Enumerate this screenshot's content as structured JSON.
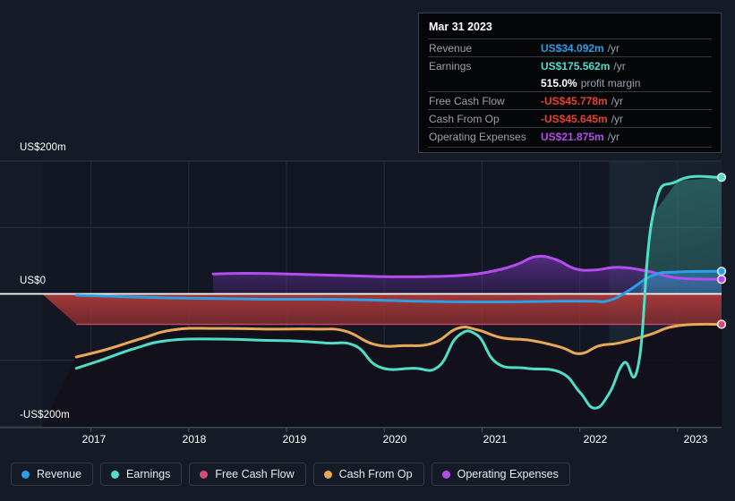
{
  "chart_data": {
    "type": "area",
    "title": "",
    "xlabel": "",
    "ylabel": "",
    "currency": "US$",
    "units": "m",
    "grid": true,
    "legend_position": "bottom",
    "ylim": [
      -200,
      200
    ],
    "yticks": [
      -200,
      0,
      200
    ],
    "ytick_labels": [
      "-US$200m",
      "US$0",
      "US$200m"
    ],
    "xlim": [
      2016.5,
      2023.45
    ],
    "xticks": [
      2017,
      2018,
      2019,
      2020,
      2021,
      2022,
      2023
    ],
    "xtick_labels": [
      "2017",
      "2018",
      "2019",
      "2020",
      "2021",
      "2022",
      "2023"
    ],
    "forecast_start": 2022.3,
    "series": [
      {
        "name": "Revenue",
        "color": "#2b9fe8",
        "x": [
          2016.85,
          2017.3,
          2017.8,
          2018.3,
          2018.8,
          2019.3,
          2019.8,
          2020.3,
          2020.8,
          2021.3,
          2021.8,
          2022.1,
          2022.3,
          2022.5,
          2022.75,
          2023.0,
          2023.45
        ],
        "values": [
          -2,
          -4,
          -6,
          -7,
          -8,
          -8,
          -9,
          -11,
          -12,
          -12,
          -11,
          -11,
          -10,
          5,
          28,
          33,
          34.092
        ]
      },
      {
        "name": "Earnings",
        "color": "#4fdfc8",
        "x": [
          2016.85,
          2017.1,
          2017.45,
          2017.8,
          2018.3,
          2018.8,
          2019.1,
          2019.4,
          2019.7,
          2019.95,
          2020.3,
          2020.55,
          2020.75,
          2020.95,
          2021.15,
          2021.45,
          2021.8,
          2022.0,
          2022.15,
          2022.3,
          2022.45,
          2022.6,
          2022.75,
          2023.0,
          2023.45
        ],
        "values": [
          -112,
          -100,
          -82,
          -70,
          -68,
          -70,
          -71,
          -74,
          -78,
          -110,
          -112,
          -110,
          -64,
          -62,
          -104,
          -112,
          -118,
          -148,
          -172,
          -150,
          -104,
          -106,
          120,
          170,
          175.562
        ]
      },
      {
        "name": "Free Cash Flow",
        "color": "#d94a77",
        "x": [
          2016.85,
          2023.45
        ],
        "values": [
          -45.778,
          -45.778
        ]
      },
      {
        "name": "Cash From Op",
        "color": "#e8a855",
        "x": [
          2016.85,
          2017.15,
          2017.5,
          2017.85,
          2018.3,
          2018.8,
          2019.3,
          2019.6,
          2019.9,
          2020.2,
          2020.5,
          2020.75,
          2020.95,
          2021.2,
          2021.5,
          2021.8,
          2022.0,
          2022.2,
          2022.4,
          2022.7,
          2023.0,
          2023.45
        ],
        "values": [
          -95,
          -84,
          -68,
          -54,
          -52,
          -53,
          -53,
          -56,
          -76,
          -78,
          -74,
          -52,
          -54,
          -66,
          -70,
          -80,
          -90,
          -78,
          -74,
          -62,
          -48,
          -45.645
        ]
      },
      {
        "name": "Operating Expenses",
        "color": "#b44cf0",
        "x": [
          2018.25,
          2018.6,
          2019.0,
          2019.5,
          2020.0,
          2020.4,
          2020.8,
          2021.1,
          2021.35,
          2021.55,
          2021.75,
          2021.95,
          2022.15,
          2022.4,
          2022.7,
          2023.0,
          2023.45
        ],
        "values": [
          30,
          31,
          30,
          28,
          26,
          26,
          28,
          34,
          44,
          56,
          52,
          38,
          36,
          40,
          34,
          24,
          21.875
        ]
      }
    ]
  },
  "tooltip": {
    "date": "Mar 31 2023",
    "rows": [
      {
        "label": "Revenue",
        "value": "US$34.092m",
        "unit": "/yr",
        "color": "#2b9fe8"
      },
      {
        "label": "Earnings",
        "value": "US$175.562m",
        "unit": "/yr",
        "color": "#4fdfc8"
      },
      {
        "label": "",
        "value": "515.0%",
        "unit": "profit margin",
        "color": "#ffffff"
      },
      {
        "label": "Free Cash Flow",
        "value": "-US$45.778m",
        "unit": "/yr",
        "color": "#e8422e"
      },
      {
        "label": "Cash From Op",
        "value": "-US$45.645m",
        "unit": "/yr",
        "color": "#e8422e"
      },
      {
        "label": "Operating Expenses",
        "value": "US$21.875m",
        "unit": "/yr",
        "color": "#b44cf0"
      }
    ]
  },
  "legend": {
    "items": [
      {
        "label": "Revenue",
        "color": "#2b9fe8"
      },
      {
        "label": "Earnings",
        "color": "#4fdfc8"
      },
      {
        "label": "Free Cash Flow",
        "color": "#d94a77"
      },
      {
        "label": "Cash From Op",
        "color": "#e8a855"
      },
      {
        "label": "Operating Expenses",
        "color": "#b44cf0"
      }
    ]
  },
  "colors": {
    "background": "#151b26",
    "grid": "#2d3340",
    "zero_line": "#ffffff",
    "axis_text": "#ffffff",
    "tooltip_bg": "#050608",
    "tooltip_border": "#3a3f49",
    "tooltip_label": "#9aa0ab"
  }
}
